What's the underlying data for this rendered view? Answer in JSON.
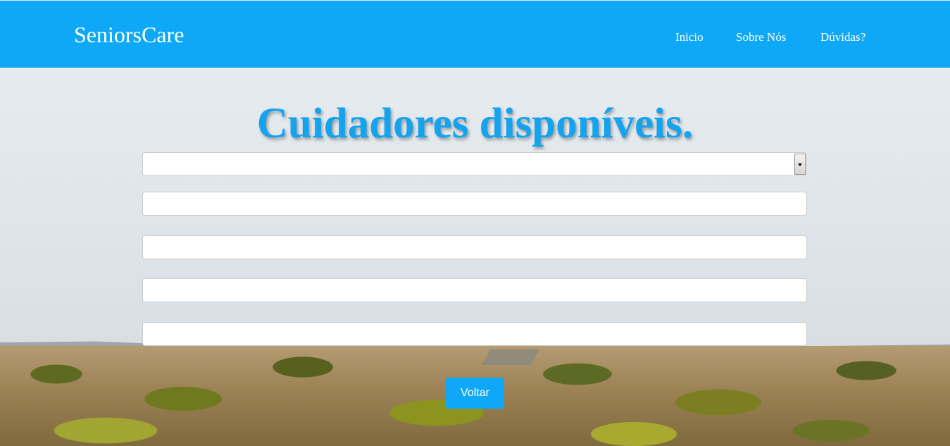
{
  "navbar": {
    "brand": "SeniorsCare",
    "links": [
      "Inicio",
      "Sobre Nós",
      "Dúvidas?"
    ]
  },
  "main": {
    "title": "Cuidadores disponíveis.",
    "select": {
      "value": ""
    },
    "fields": [
      {
        "value": "",
        "placeholder": ""
      },
      {
        "value": "",
        "placeholder": ""
      },
      {
        "value": "",
        "placeholder": ""
      },
      {
        "value": "",
        "placeholder": ""
      }
    ],
    "back_button": "Voltar"
  },
  "colors": {
    "accent": "#0ea8f6",
    "title": "#14a3ee"
  }
}
